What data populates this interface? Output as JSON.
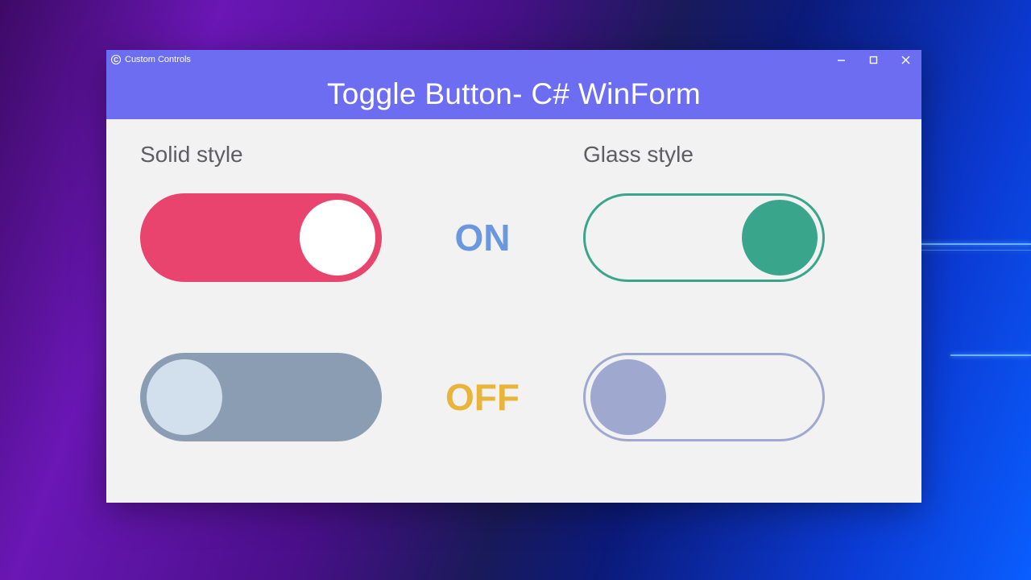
{
  "window": {
    "title": "Custom Controls",
    "minimize": "−",
    "maximize": "☐",
    "close": "✕"
  },
  "banner": {
    "title": "Toggle Button- C# WinForm"
  },
  "headings": {
    "solid": "Solid style",
    "glass": "Glass style"
  },
  "status": {
    "on": "ON",
    "off": "OFF"
  },
  "toggles": {
    "solid_on": {
      "checked": true
    },
    "solid_off": {
      "checked": false
    },
    "glass_on": {
      "checked": true
    },
    "glass_off": {
      "checked": false
    }
  },
  "colors": {
    "accent": "#6d6df2",
    "solid_on_track": "#e9446e",
    "solid_off_track": "#8a9db2",
    "solid_off_knob": "#d2dfed",
    "glass_on": "#39a68b",
    "glass_off": "#9fa9d0",
    "on_text": "#6b97e0",
    "off_text": "#e8b53a"
  }
}
